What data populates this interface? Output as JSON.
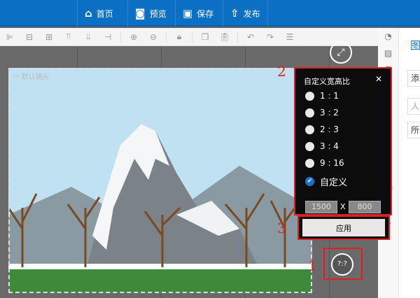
{
  "nav": [
    {
      "icon": "home-icon",
      "label": "首页"
    },
    {
      "icon": "preview-icon",
      "label": "预览"
    },
    {
      "icon": "save-icon",
      "label": "保存"
    },
    {
      "icon": "publish-icon",
      "label": "发布"
    }
  ],
  "canvas": {
    "camera_label": "默认镜头"
  },
  "popup": {
    "title": "自定义宽高比",
    "options": [
      "1 : 1",
      "3 : 2",
      "2 : 3",
      "3 : 4",
      "9 : 16",
      "自定义"
    ],
    "selected": "自定义",
    "width": "1500",
    "height": "800",
    "x": "X",
    "apply": "应用"
  },
  "ratio_button": "?:?",
  "annotations": [
    "1",
    "2",
    "3"
  ],
  "right_panel": {
    "title": "图",
    "items": [
      "添",
      "人",
      "所"
    ]
  }
}
